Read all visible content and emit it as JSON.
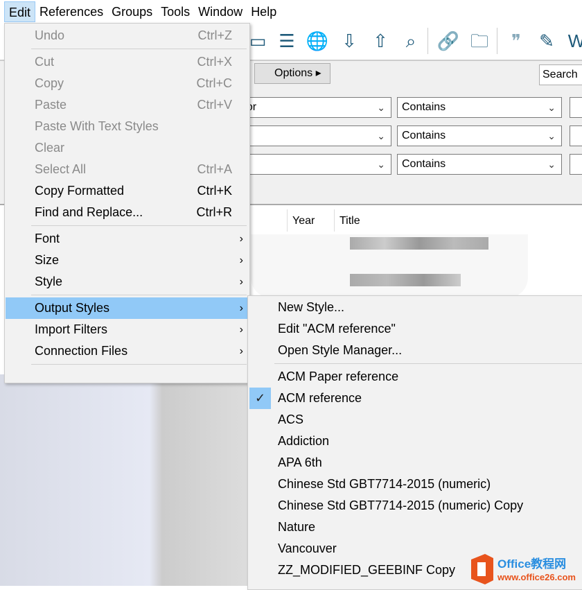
{
  "menubar": [
    "Edit",
    "References",
    "Groups",
    "Tools",
    "Window",
    "Help"
  ],
  "search": {
    "options_label": "Options",
    "search_label": "Search",
    "rows": [
      {
        "field": "hor",
        "op": "Contains"
      },
      {
        "field": "",
        "op": "Contains"
      },
      {
        "field": "",
        "op": "Contains"
      }
    ]
  },
  "table": {
    "columns": [
      "Year",
      "Title"
    ]
  },
  "edit_menu": [
    {
      "label": "Undo",
      "shortcut": "Ctrl+Z",
      "disabled": true
    },
    {
      "sep": true
    },
    {
      "label": "Cut",
      "shortcut": "Ctrl+X",
      "disabled": true
    },
    {
      "label": "Copy",
      "shortcut": "Ctrl+C",
      "disabled": true
    },
    {
      "label": "Paste",
      "shortcut": "Ctrl+V",
      "disabled": true
    },
    {
      "label": "Paste With Text Styles",
      "shortcut": "",
      "disabled": true
    },
    {
      "label": "Clear",
      "shortcut": "",
      "disabled": true
    },
    {
      "label": "Select All",
      "shortcut": "Ctrl+A",
      "disabled": true
    },
    {
      "label": "Copy Formatted",
      "shortcut": "Ctrl+K"
    },
    {
      "label": "Find and Replace...",
      "shortcut": "Ctrl+R"
    },
    {
      "sep": true
    },
    {
      "label": "Font",
      "submenu": true
    },
    {
      "label": "Size",
      "submenu": true
    },
    {
      "label": "Style",
      "submenu": true
    },
    {
      "sep": true
    },
    {
      "label": "Output Styles",
      "submenu": true,
      "highlighted": true
    },
    {
      "label": "Import Filters",
      "submenu": true
    },
    {
      "label": "Connection Files",
      "submenu": true
    },
    {
      "sep": true
    }
  ],
  "output_styles_menu": {
    "actions": [
      "New Style...",
      "Edit \"ACM reference\"",
      "Open Style Manager..."
    ],
    "styles": [
      "ACM Paper reference",
      "ACM reference",
      "ACS",
      "Addiction",
      "APA 6th",
      "Chinese Std GBT7714-2015 (numeric)",
      "Chinese Std GBT7714-2015 (numeric) Copy",
      "Nature",
      "Vancouver",
      "ZZ_MODIFIED_GEEBINF Copy"
    ],
    "checked": "ACM reference"
  },
  "colors": {
    "highlight": "#91c9f7",
    "menu_bg": "#f2f2f2",
    "icon": "#1e5a7a"
  }
}
